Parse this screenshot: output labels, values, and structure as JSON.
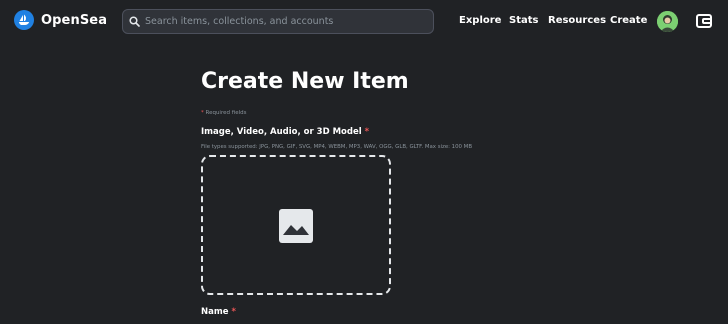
{
  "header": {
    "logo_text": "OpenSea",
    "search_placeholder": "Search items, collections, and accounts",
    "nav": [
      "Explore",
      "Stats",
      "Resources",
      "Create"
    ]
  },
  "main": {
    "title": "Create New Item",
    "required_star": "*",
    "required_note": "Required fields",
    "media_label": "Image, Video, Audio, or 3D Model",
    "file_types": "File types supported: JPG, PNG, GIF, SVG, MP4, WEBM, MP3, WAV, OGG, GLB, GLTF. Max size: 100 MB",
    "name_label": "Name"
  },
  "colors": {
    "background": "#202225",
    "accent": "#2081e2",
    "required": "#eb5757"
  }
}
